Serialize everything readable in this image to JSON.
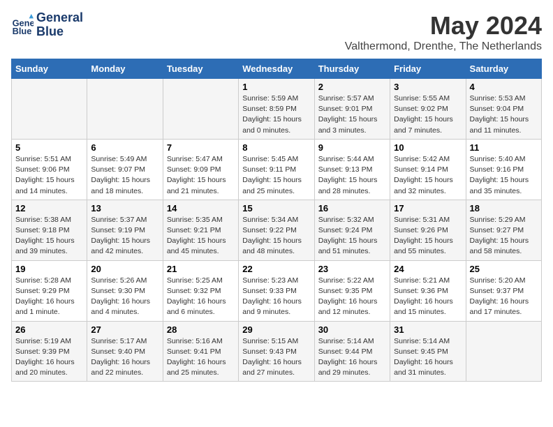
{
  "header": {
    "logo_line1": "General",
    "logo_line2": "Blue",
    "month": "May 2024",
    "location": "Valthermond, Drenthe, The Netherlands"
  },
  "weekdays": [
    "Sunday",
    "Monday",
    "Tuesday",
    "Wednesday",
    "Thursday",
    "Friday",
    "Saturday"
  ],
  "weeks": [
    [
      {
        "day": "",
        "info": ""
      },
      {
        "day": "",
        "info": ""
      },
      {
        "day": "",
        "info": ""
      },
      {
        "day": "1",
        "info": "Sunrise: 5:59 AM\nSunset: 8:59 PM\nDaylight: 15 hours\nand 0 minutes."
      },
      {
        "day": "2",
        "info": "Sunrise: 5:57 AM\nSunset: 9:01 PM\nDaylight: 15 hours\nand 3 minutes."
      },
      {
        "day": "3",
        "info": "Sunrise: 5:55 AM\nSunset: 9:02 PM\nDaylight: 15 hours\nand 7 minutes."
      },
      {
        "day": "4",
        "info": "Sunrise: 5:53 AM\nSunset: 9:04 PM\nDaylight: 15 hours\nand 11 minutes."
      }
    ],
    [
      {
        "day": "5",
        "info": "Sunrise: 5:51 AM\nSunset: 9:06 PM\nDaylight: 15 hours\nand 14 minutes."
      },
      {
        "day": "6",
        "info": "Sunrise: 5:49 AM\nSunset: 9:07 PM\nDaylight: 15 hours\nand 18 minutes."
      },
      {
        "day": "7",
        "info": "Sunrise: 5:47 AM\nSunset: 9:09 PM\nDaylight: 15 hours\nand 21 minutes."
      },
      {
        "day": "8",
        "info": "Sunrise: 5:45 AM\nSunset: 9:11 PM\nDaylight: 15 hours\nand 25 minutes."
      },
      {
        "day": "9",
        "info": "Sunrise: 5:44 AM\nSunset: 9:13 PM\nDaylight: 15 hours\nand 28 minutes."
      },
      {
        "day": "10",
        "info": "Sunrise: 5:42 AM\nSunset: 9:14 PM\nDaylight: 15 hours\nand 32 minutes."
      },
      {
        "day": "11",
        "info": "Sunrise: 5:40 AM\nSunset: 9:16 PM\nDaylight: 15 hours\nand 35 minutes."
      }
    ],
    [
      {
        "day": "12",
        "info": "Sunrise: 5:38 AM\nSunset: 9:18 PM\nDaylight: 15 hours\nand 39 minutes."
      },
      {
        "day": "13",
        "info": "Sunrise: 5:37 AM\nSunset: 9:19 PM\nDaylight: 15 hours\nand 42 minutes."
      },
      {
        "day": "14",
        "info": "Sunrise: 5:35 AM\nSunset: 9:21 PM\nDaylight: 15 hours\nand 45 minutes."
      },
      {
        "day": "15",
        "info": "Sunrise: 5:34 AM\nSunset: 9:22 PM\nDaylight: 15 hours\nand 48 minutes."
      },
      {
        "day": "16",
        "info": "Sunrise: 5:32 AM\nSunset: 9:24 PM\nDaylight: 15 hours\nand 51 minutes."
      },
      {
        "day": "17",
        "info": "Sunrise: 5:31 AM\nSunset: 9:26 PM\nDaylight: 15 hours\nand 55 minutes."
      },
      {
        "day": "18",
        "info": "Sunrise: 5:29 AM\nSunset: 9:27 PM\nDaylight: 15 hours\nand 58 minutes."
      }
    ],
    [
      {
        "day": "19",
        "info": "Sunrise: 5:28 AM\nSunset: 9:29 PM\nDaylight: 16 hours\nand 1 minute."
      },
      {
        "day": "20",
        "info": "Sunrise: 5:26 AM\nSunset: 9:30 PM\nDaylight: 16 hours\nand 4 minutes."
      },
      {
        "day": "21",
        "info": "Sunrise: 5:25 AM\nSunset: 9:32 PM\nDaylight: 16 hours\nand 6 minutes."
      },
      {
        "day": "22",
        "info": "Sunrise: 5:23 AM\nSunset: 9:33 PM\nDaylight: 16 hours\nand 9 minutes."
      },
      {
        "day": "23",
        "info": "Sunrise: 5:22 AM\nSunset: 9:35 PM\nDaylight: 16 hours\nand 12 minutes."
      },
      {
        "day": "24",
        "info": "Sunrise: 5:21 AM\nSunset: 9:36 PM\nDaylight: 16 hours\nand 15 minutes."
      },
      {
        "day": "25",
        "info": "Sunrise: 5:20 AM\nSunset: 9:37 PM\nDaylight: 16 hours\nand 17 minutes."
      }
    ],
    [
      {
        "day": "26",
        "info": "Sunrise: 5:19 AM\nSunset: 9:39 PM\nDaylight: 16 hours\nand 20 minutes."
      },
      {
        "day": "27",
        "info": "Sunrise: 5:17 AM\nSunset: 9:40 PM\nDaylight: 16 hours\nand 22 minutes."
      },
      {
        "day": "28",
        "info": "Sunrise: 5:16 AM\nSunset: 9:41 PM\nDaylight: 16 hours\nand 25 minutes."
      },
      {
        "day": "29",
        "info": "Sunrise: 5:15 AM\nSunset: 9:43 PM\nDaylight: 16 hours\nand 27 minutes."
      },
      {
        "day": "30",
        "info": "Sunrise: 5:14 AM\nSunset: 9:44 PM\nDaylight: 16 hours\nand 29 minutes."
      },
      {
        "day": "31",
        "info": "Sunrise: 5:14 AM\nSunset: 9:45 PM\nDaylight: 16 hours\nand 31 minutes."
      },
      {
        "day": "",
        "info": ""
      }
    ]
  ]
}
